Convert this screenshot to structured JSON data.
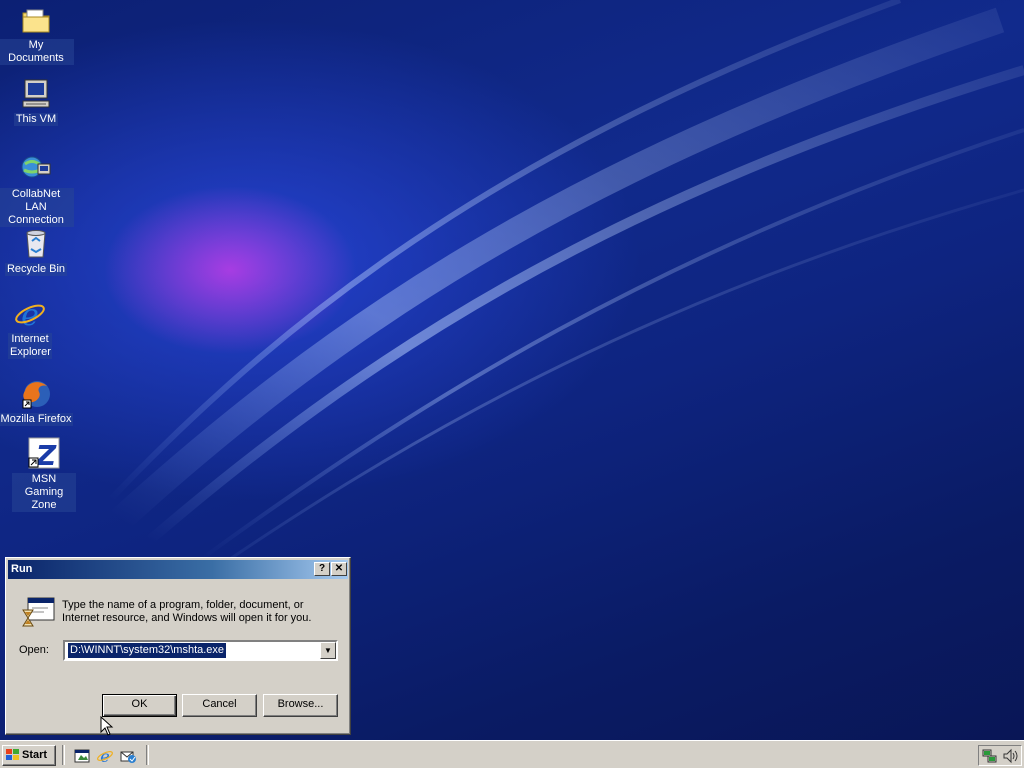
{
  "desktop": {
    "icons": [
      {
        "label": "My Documents"
      },
      {
        "label": "This VM"
      },
      {
        "label": "CollabNet LAN Connection"
      },
      {
        "label": "Recycle Bin"
      },
      {
        "label": "Internet Explorer"
      },
      {
        "label": "Mozilla Firefox"
      },
      {
        "label": "MSN Gaming Zone"
      }
    ]
  },
  "run_dialog": {
    "title": "Run",
    "help_label": "?",
    "close_label": "✕",
    "description": "Type the name of a program, folder, document, or Internet resource, and Windows will open it for you.",
    "open_label": "Open:",
    "open_value": "D:\\WINNT\\system32\\mshta.exe",
    "ok_label": "OK",
    "cancel_label": "Cancel",
    "browse_label": "Browse..."
  },
  "taskbar": {
    "start_label": "Start",
    "quick_launch": [
      "show-desktop-icon",
      "internet-explorer-icon",
      "outlook-express-icon"
    ],
    "tray_icons": [
      "network-icon",
      "volume-icon"
    ]
  },
  "colors": {
    "titlebar_start": "#0a246a",
    "titlebar_end": "#a6caf0",
    "face": "#d4d0c8",
    "selection": "#0a246a"
  }
}
